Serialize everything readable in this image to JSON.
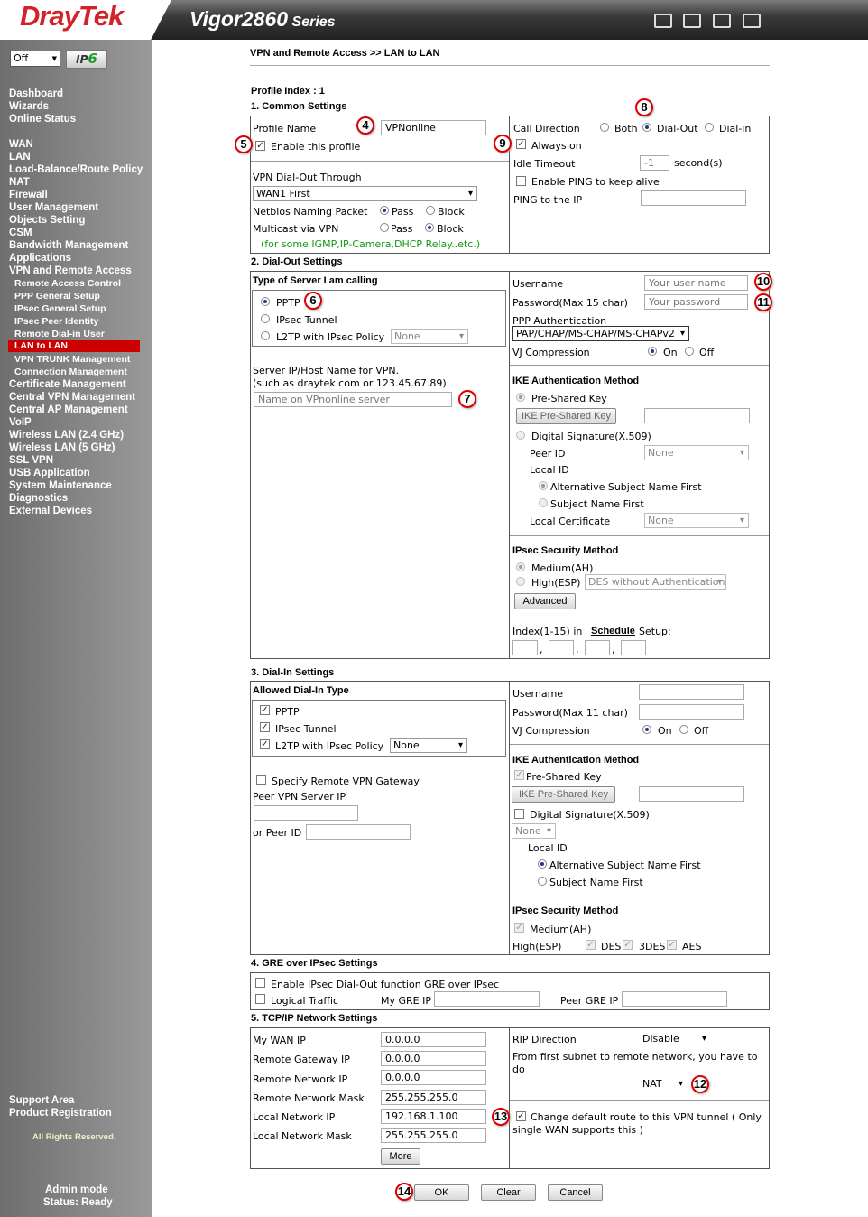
{
  "header": {
    "logo": "DrayTek",
    "model": "Vigor2860",
    "series": " Series"
  },
  "sidebar": {
    "lang_select": "Off",
    "ipv6_label": "IP",
    "ipv6_suffix": "6",
    "items": [
      "Dashboard",
      "Wizards",
      "Online Status",
      "WAN",
      "LAN",
      "Load-Balance/Route Policy",
      "NAT",
      "Firewall",
      "User Management",
      "Objects Setting",
      "CSM",
      "Bandwidth Management",
      "Applications",
      "VPN and Remote Access"
    ],
    "subitems": [
      "Remote Access Control",
      "PPP General Setup",
      "IPsec General Setup",
      "IPsec Peer Identity",
      "Remote Dial-in User",
      "LAN to LAN",
      "VPN TRUNK Management",
      "Connection Management"
    ],
    "items2": [
      "Certificate Management",
      "Central VPN Management",
      "Central AP Management",
      "VoIP",
      "Wireless LAN (2.4 GHz)",
      "Wireless LAN (5 GHz)",
      "SSL VPN",
      "USB Application",
      "System Maintenance",
      "Diagnostics",
      "External Devices"
    ],
    "support": "Support Area",
    "registration": "Product Registration",
    "rights": "All Rights Reserved.",
    "admin": "Admin mode",
    "status": "Status: Ready"
  },
  "main": {
    "breadcrumb": "VPN and Remote Access >> LAN to LAN",
    "profile_index": "Profile Index : 1",
    "s1": "1. Common Settings",
    "profile_name_label": "Profile Name",
    "profile_name_value": "VPNonline",
    "enable_profile": "Enable this profile",
    "dialout_through_label": "VPN Dial-Out Through",
    "dialout_through_value": "WAN1 First",
    "netbios_label": "Netbios Naming Packet",
    "pass": "Pass",
    "block": "Block",
    "multicast_label": "Multicast via VPN",
    "multicast_note": "(for some IGMP,IP-Camera,DHCP Relay..etc.)",
    "call_direction": "Call Direction",
    "both": "Both",
    "dial_out": "Dial-Out",
    "dial_in": "Dial-in",
    "always_on": "Always on",
    "idle_timeout": "Idle Timeout",
    "idle_value": "-1",
    "seconds": "second(s)",
    "enable_ping": "Enable PING to keep alive",
    "ping_ip": "PING to the IP",
    "s2": "2. Dial-Out Settings",
    "server_type": "Type of Server I am calling",
    "pptp": "PPTP",
    "ipsec_tunnel": "IPsec Tunnel",
    "l2tp": "L2TP with IPsec Policy",
    "none": "None",
    "server_ip_label1": "Server IP/Host Name for VPN.",
    "server_ip_label2": "(such as draytek.com or 123.45.67.89)",
    "server_ip_placeholder": "Name on VPnonline server",
    "username": "Username",
    "username_ph": "Your user name",
    "password15": "Password(Max 15 char)",
    "password_ph": "Your password",
    "ppp_auth": "PPP Authentication",
    "ppp_auth_value": "PAP/CHAP/MS-CHAP/MS-CHAPv2",
    "vj": "VJ Compression",
    "on": "On",
    "off": "Off",
    "ike_auth": "IKE Authentication Method",
    "psk": "Pre-Shared Key",
    "ike_psk_btn": "IKE Pre-Shared Key",
    "digital_sig": "Digital Signature(X.509)",
    "peer_id": "Peer ID",
    "local_id": "Local ID",
    "alt_subject": "Alternative Subject Name First",
    "subject": "Subject Name First",
    "local_cert": "Local Certificate",
    "ipsec_method": "IPsec Security Method",
    "medium_ah": "Medium(AH)",
    "high_esp": "High(ESP)",
    "esp_value": "DES without Authentication",
    "advanced": "Advanced",
    "index_label": "Index(1-15) in",
    "schedule": "Schedule",
    "setup": "Setup:",
    "comma": ",",
    "s3": "3. Dial-In Settings",
    "allowed_dialin": "Allowed Dial-In Type",
    "specify_gw": "Specify Remote VPN Gateway",
    "peer_vpn_ip": "Peer VPN Server IP",
    "or_peer_id": "or Peer ID",
    "password11": "Password(Max 11 char)",
    "des": "DES",
    "tdes": "3DES",
    "aes": "AES",
    "s4": "4. GRE over IPsec Settings",
    "gre_enable": "Enable IPsec Dial-Out function GRE over IPsec",
    "logical_traffic": "Logical Traffic",
    "my_gre_ip": "My GRE IP",
    "peer_gre_ip": "Peer GRE IP",
    "s5": "5. TCP/IP Network Settings",
    "my_wan_ip": "My WAN IP",
    "my_wan_ip_v": "0.0.0.0",
    "remote_gw": "Remote Gateway IP",
    "remote_gw_v": "0.0.0.0",
    "remote_net": "Remote Network IP",
    "remote_net_v": "0.0.0.0",
    "remote_mask": "Remote Network Mask",
    "remote_mask_v": "255.255.255.0",
    "local_net": "Local Network IP",
    "local_net_v": "192.168.1.100",
    "local_mask": "Local Network Mask",
    "local_mask_v": "255.255.255.0",
    "more": "More",
    "rip_dir": "RIP Direction",
    "rip_value": "Disable",
    "first_subnet1": "From first subnet to remote network, you have to",
    "first_subnet2": "do",
    "nat_value": "NAT",
    "change_route1": "Change default route to this VPN tunnel ( Only",
    "change_route2": "single WAN supports this )",
    "ok": "OK",
    "clear": "Clear",
    "cancel": "Cancel"
  },
  "callouts": [
    "4",
    "5",
    "6",
    "7",
    "8",
    "9",
    "10",
    "11",
    "12",
    "13",
    "14"
  ]
}
